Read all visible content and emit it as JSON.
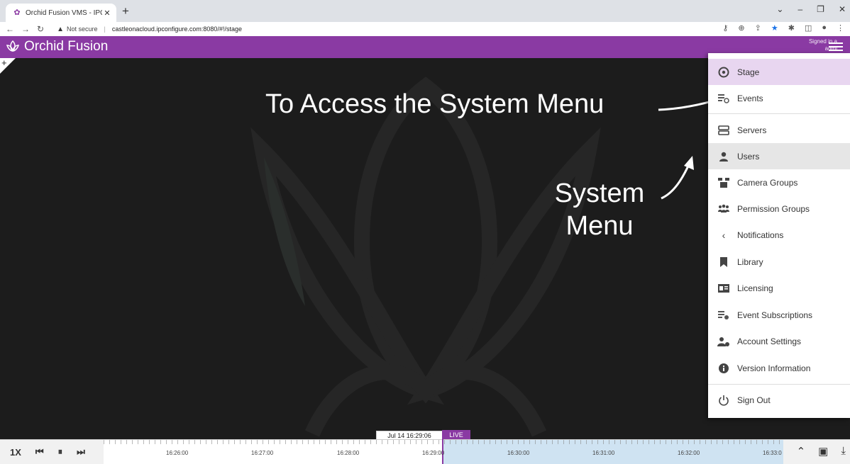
{
  "browser": {
    "tab_title": "Orchid Fusion VMS - IPConfigure",
    "tab_close": "✕",
    "new_tab": "+",
    "not_secure": "Not secure",
    "url": "castleonacloud.ipconfigure.com:8080/#!/stage",
    "window_controls": [
      "⌄",
      "–",
      "❐",
      "✕"
    ]
  },
  "app": {
    "name": "Orchid Fusion",
    "signed_in_line1": "Signed in a",
    "signed_in_line2": "admi"
  },
  "annotations": {
    "top": "To Access the System Menu",
    "side_line1": "System",
    "side_line2": "Menu"
  },
  "menu": {
    "items": [
      {
        "label": "Stage",
        "icon": "eye-icon"
      },
      {
        "label": "Events",
        "icon": "events-icon"
      },
      {
        "label": "Servers",
        "icon": "servers-icon"
      },
      {
        "label": "Users",
        "icon": "user-icon"
      },
      {
        "label": "Camera Groups",
        "icon": "camera-groups-icon"
      },
      {
        "label": "Permission Groups",
        "icon": "permission-groups-icon"
      },
      {
        "label": "Notifications",
        "icon": "chevron-left-icon"
      },
      {
        "label": "Library",
        "icon": "bookmark-icon"
      },
      {
        "label": "Licensing",
        "icon": "license-icon"
      },
      {
        "label": "Event Subscriptions",
        "icon": "event-subscriptions-icon"
      },
      {
        "label": "Account Settings",
        "icon": "account-settings-icon"
      },
      {
        "label": "Version Information",
        "icon": "info-icon"
      },
      {
        "label": "Sign Out",
        "icon": "power-icon"
      }
    ]
  },
  "timeline": {
    "speed": "1X",
    "current_time": "Jul 14 16:29:06",
    "live": "LIVE",
    "labels": [
      "16:26:00",
      "16:27:00",
      "16:28:00",
      "16:29:00",
      "16:30:00",
      "16:31:00",
      "16:32:00",
      "16:33:0"
    ]
  },
  "colors": {
    "brand": "#8a3aa3",
    "stage_bg": "#1c1c1c",
    "live_region": "#cfe3f2"
  }
}
